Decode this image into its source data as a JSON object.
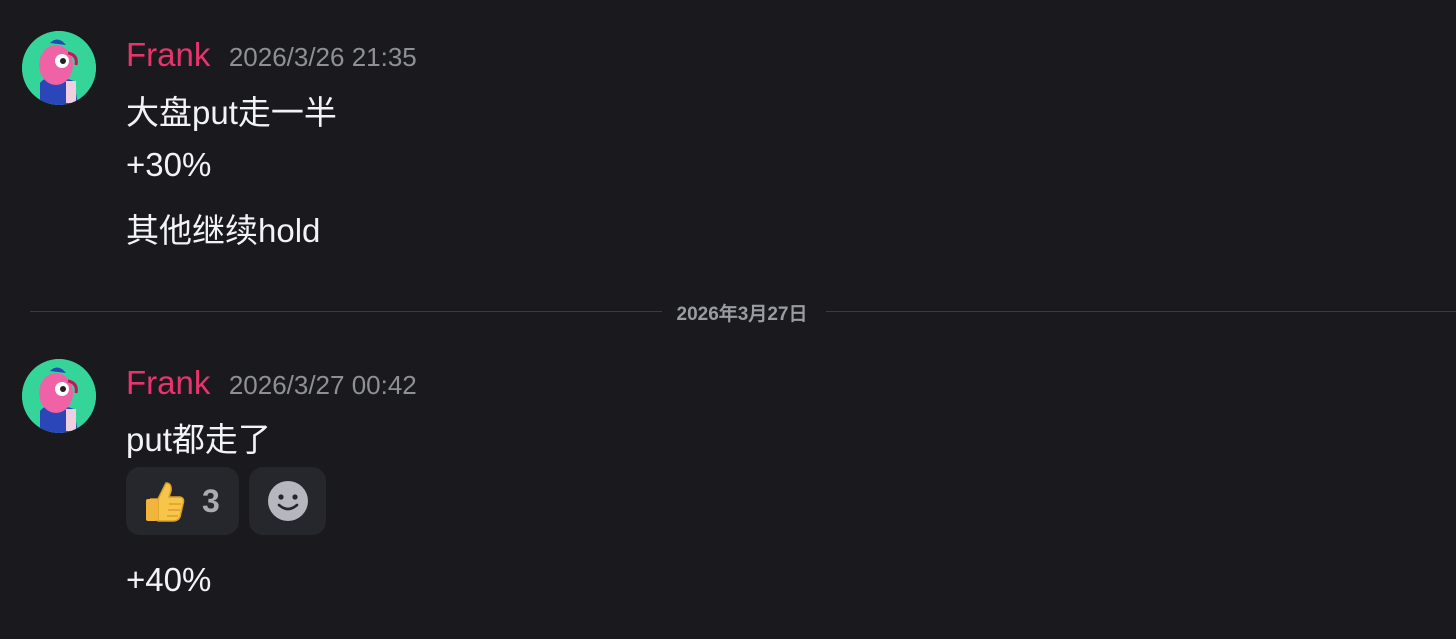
{
  "messages": [
    {
      "username": "Frank",
      "timestamp": "2026/3/26 21:35",
      "lines": [
        "大盘put走一半",
        "+30%",
        "其他继续hold"
      ]
    },
    {
      "username": "Frank",
      "timestamp": "2026/3/27 00:42",
      "lines": [
        "put都走了"
      ],
      "reactions": [
        {
          "emoji": "👍",
          "count": "3"
        }
      ],
      "after_lines": [
        "+40%"
      ]
    }
  ],
  "date_divider": "2026年3月27日",
  "colors": {
    "background": "#1a1a1e",
    "username": "#e8336d",
    "timestamp": "#8e9097",
    "reaction_bg": "#26272c"
  },
  "icons": {
    "avatar": "cartoon-character-avatar",
    "add_reaction": "smiley-face-icon"
  }
}
